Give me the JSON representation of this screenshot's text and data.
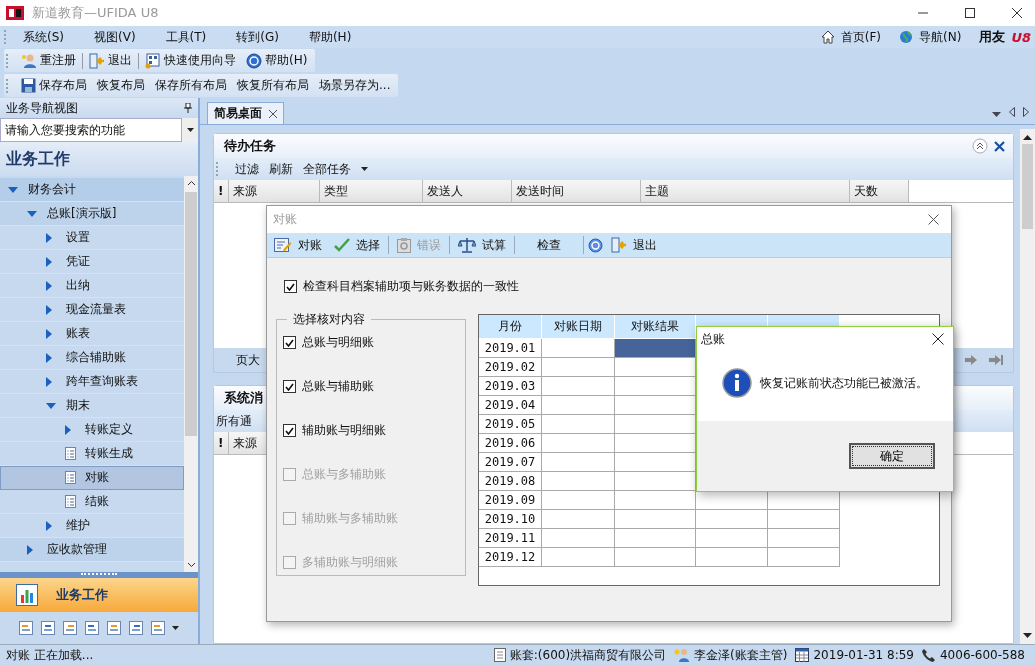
{
  "window": {
    "title": "新道教育—UFIDA U8"
  },
  "menu": [
    "系统(S)",
    "视图(V)",
    "工具(T)",
    "转到(G)",
    "帮助(H)"
  ],
  "nav_links": [
    "首页(F)",
    "导航(N)"
  ],
  "brand": {
    "name": "用友",
    "mark": "U8"
  },
  "toolbar_main": [
    "重注册",
    "退出",
    "快速使用向导",
    "帮助(H)"
  ],
  "toolbar_layout": [
    "保存布局",
    "恢复布局",
    "保存所有布局",
    "恢复所有布局",
    "场景另存为..."
  ],
  "sidebar": {
    "title": "业务导航视图",
    "search": {
      "placeholder": "请输入您要搜索的功能"
    },
    "heading": "业务工作",
    "tree": [
      {
        "label": "财务会计",
        "kind": "folder",
        "expanded": true,
        "selected": false,
        "children": [
          {
            "label": "总账[演示版]",
            "kind": "folder",
            "expanded": true,
            "selected": false,
            "children": [
              {
                "label": "设置",
                "kind": "folder",
                "expanded": false,
                "selected": false
              },
              {
                "label": "凭证",
                "kind": "folder",
                "expanded": false,
                "selected": false
              },
              {
                "label": "出纳",
                "kind": "folder",
                "expanded": false,
                "selected": false
              },
              {
                "label": "现金流量表",
                "kind": "folder",
                "expanded": false,
                "selected": false
              },
              {
                "label": "账表",
                "kind": "folder",
                "expanded": false,
                "selected": false
              },
              {
                "label": "综合辅助账",
                "kind": "folder",
                "expanded": false,
                "selected": false
              },
              {
                "label": "跨年查询账表",
                "kind": "folder",
                "expanded": false,
                "selected": false
              },
              {
                "label": "期末",
                "kind": "folder",
                "expanded": true,
                "selected": false,
                "children": [
                  {
                    "label": "转账定义",
                    "kind": "folder",
                    "expanded": false,
                    "selected": false
                  },
                  {
                    "label": "转账生成",
                    "kind": "doc",
                    "selected": false
                  },
                  {
                    "label": "对账",
                    "kind": "doc",
                    "selected": true
                  },
                  {
                    "label": "结账",
                    "kind": "doc",
                    "selected": false
                  }
                ]
              },
              {
                "label": "维护",
                "kind": "folder",
                "expanded": false,
                "selected": false
              }
            ]
          },
          {
            "label": "应收款管理",
            "kind": "folder",
            "expanded": false,
            "selected": false
          }
        ]
      }
    ],
    "bottom_button": "业务工作"
  },
  "tabs": [
    {
      "label": "简易桌面",
      "selected": true
    }
  ],
  "todo_panel": {
    "title": "待办任务",
    "toolbar": [
      "过滤",
      "刷新",
      "全部任务"
    ],
    "columns": [
      "!",
      "来源",
      "类型",
      "发送人",
      "发送时间",
      "主题",
      "天数"
    ],
    "pager_label": "页大"
  },
  "messages_panel": {
    "title": "系统消",
    "toolbar": "所有通",
    "columns": [
      "!",
      "来源"
    ]
  },
  "dialog": {
    "title": "对账",
    "toolbar": [
      {
        "label": "对账",
        "disabled": false
      },
      {
        "label": "选择",
        "disabled": false
      },
      {
        "label": "错误",
        "disabled": true
      },
      {
        "label": "试算",
        "disabled": false
      },
      {
        "label": "检查",
        "disabled": false
      },
      {
        "label": "退出",
        "disabled": false
      }
    ],
    "consistency_check": {
      "label": "检查科目档案辅助项与账务数据的一致性",
      "checked": true
    },
    "group": {
      "title": "选择核对内容",
      "options": [
        {
          "label": "总账与明细账",
          "checked": true,
          "disabled": false
        },
        {
          "label": "总账与辅助账",
          "checked": true,
          "disabled": false
        },
        {
          "label": "辅助账与明细账",
          "checked": true,
          "disabled": false
        },
        {
          "label": "总账与多辅助账",
          "checked": false,
          "disabled": true
        },
        {
          "label": "辅助账与多辅助账",
          "checked": false,
          "disabled": true
        },
        {
          "label": "多辅助账与明细账",
          "checked": false,
          "disabled": true
        }
      ]
    },
    "grid": {
      "columns": [
        "月份",
        "对账日期",
        "对账结果"
      ],
      "rows": [
        {
          "month": "2019.01",
          "selected": true
        },
        {
          "month": "2019.02",
          "selected": false
        },
        {
          "month": "2019.03",
          "selected": false
        },
        {
          "month": "2019.04",
          "selected": false
        },
        {
          "month": "2019.05",
          "selected": false
        },
        {
          "month": "2019.06",
          "selected": false
        },
        {
          "month": "2019.07",
          "selected": false
        },
        {
          "month": "2019.08",
          "selected": false
        },
        {
          "month": "2019.09",
          "selected": false
        },
        {
          "month": "2019.10",
          "selected": false
        },
        {
          "month": "2019.11",
          "selected": false
        },
        {
          "month": "2019.12",
          "selected": false
        }
      ]
    }
  },
  "message_box": {
    "title": "总账",
    "message": "恢复记账前状态功能已被激活。",
    "button": "确定"
  },
  "status_bar": {
    "left": "对账 正在加载...",
    "items": [
      "账套:(600)洪福商贸有限公司",
      "李金泽(账套主管)",
      "2019-01-31 8:59",
      "4006-600-588"
    ]
  }
}
